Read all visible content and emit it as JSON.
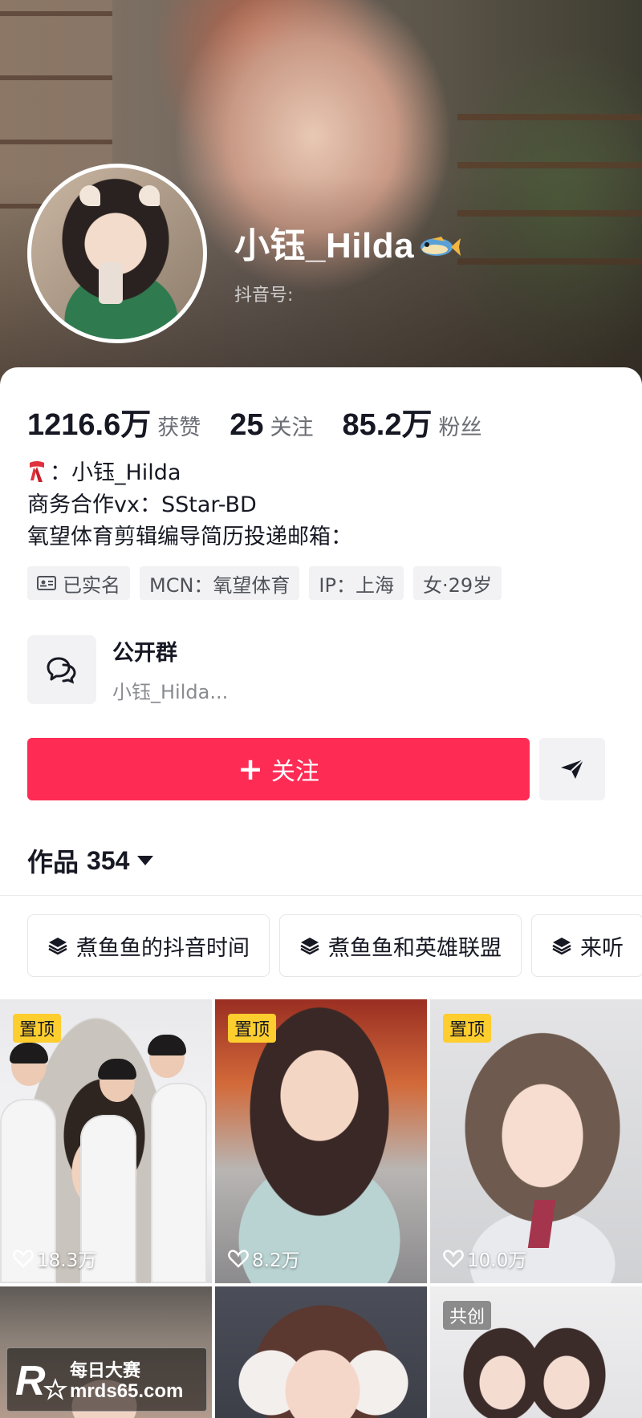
{
  "profile": {
    "display_name": "小钰_Hilda",
    "name_emoji_icon": "fish-icon",
    "douyin_id_label": "抖音号:"
  },
  "stats": [
    {
      "value": "1216.6万",
      "label": "获赞"
    },
    {
      "value": "25",
      "label": "关注"
    },
    {
      "value": "85.2万",
      "label": "粉丝"
    }
  ],
  "bio": {
    "line1_text": "：小钰_Hilda",
    "line1_icon": "scarf-icon",
    "line2": "商务合作vx：SStar-BD",
    "line3": "氧望体育剪辑编导简历投递邮箱："
  },
  "tags": [
    {
      "label": "已实名",
      "icon": "id-card-icon"
    },
    {
      "label": "MCN：氧望体育"
    },
    {
      "label": "IP：上海"
    },
    {
      "label": "女·29岁"
    }
  ],
  "group": {
    "title": "公开群",
    "subtitle": "小钰_Hilda..."
  },
  "actions": {
    "follow_label": "关注",
    "follow_icon": "plus-icon",
    "share_icon": "send-icon",
    "follow_color": "#fe2c55"
  },
  "works": {
    "label": "作品",
    "count": "354"
  },
  "collections": [
    {
      "label": "煮鱼鱼的抖音时间"
    },
    {
      "label": "煮鱼鱼和英雄联盟"
    },
    {
      "label": "来听"
    }
  ],
  "videos": [
    {
      "badge": "置顶",
      "likes": "18.3万"
    },
    {
      "badge": "置顶",
      "likes": "8.2万"
    },
    {
      "badge": "置顶",
      "likes": "10.0万"
    },
    {
      "badge": "",
      "likes": ""
    },
    {
      "badge": "",
      "likes": ""
    },
    {
      "badge": "共创",
      "likes": ""
    }
  ],
  "watermark": {
    "title": "每日大赛",
    "url": "mrds65.com"
  },
  "colors": {
    "pin_badge": "#fecd2e",
    "text_primary": "#161823"
  }
}
